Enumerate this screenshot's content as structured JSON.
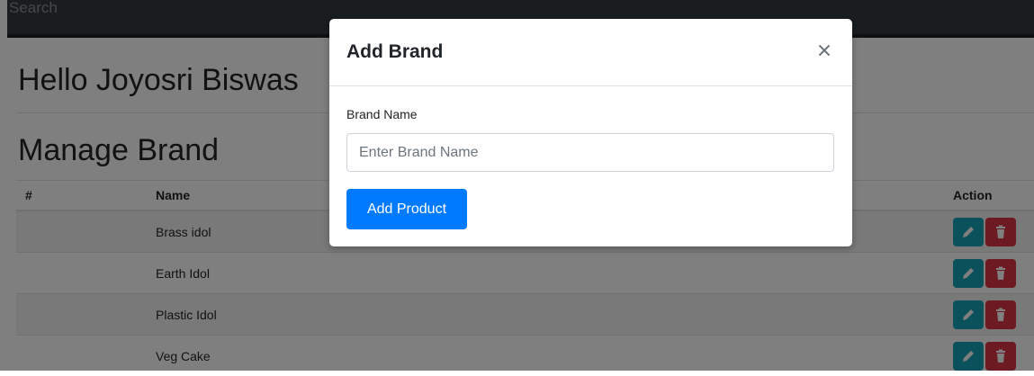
{
  "navbar": {
    "search_placeholder": "Search"
  },
  "header": {
    "greeting": "Hello Joyosri Biswas"
  },
  "page": {
    "title": "Manage Brand"
  },
  "table": {
    "columns": {
      "num": "#",
      "name": "Name",
      "action": "Action"
    },
    "rows": [
      {
        "num": "",
        "name": "Brass idol"
      },
      {
        "num": "",
        "name": "Earth Idol"
      },
      {
        "num": "",
        "name": "Plastic Idol"
      },
      {
        "num": "",
        "name": "Veg Cake"
      }
    ],
    "edit_icon": "pencil-icon",
    "delete_icon": "trash-icon"
  },
  "modal": {
    "title": "Add Brand",
    "close_icon": "close-icon",
    "field_label": "Brand Name",
    "field_placeholder": "Enter Brand Name",
    "field_value": "",
    "submit_label": "Add Product"
  },
  "colors": {
    "primary": "#007bff",
    "edit": "#17a2b8",
    "delete": "#dc3545",
    "navbar": "#343a40"
  }
}
